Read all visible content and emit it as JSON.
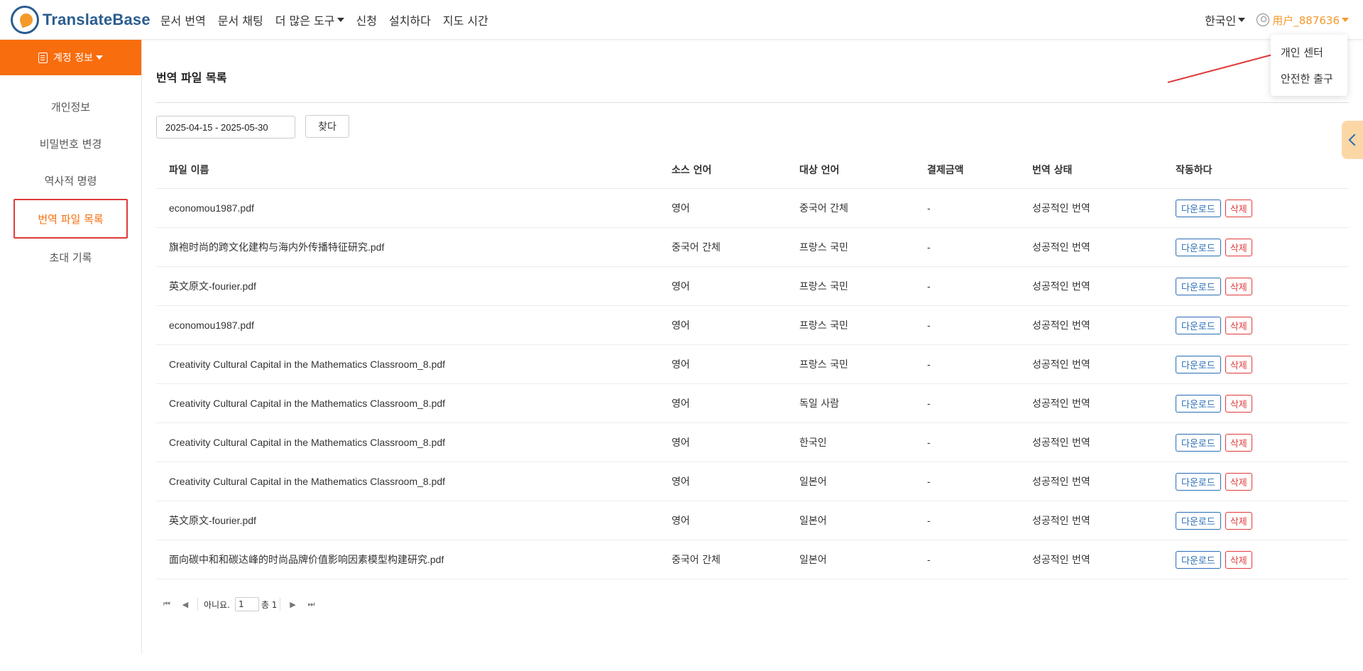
{
  "header": {
    "logo_text": "TranslateBase",
    "nav": [
      {
        "label": "문서 번역",
        "has_caret": false
      },
      {
        "label": "문서 채팅",
        "has_caret": false
      },
      {
        "label": "더 많은 도구",
        "has_caret": true
      },
      {
        "label": "신청",
        "has_caret": false
      },
      {
        "label": "설치하다",
        "has_caret": false
      },
      {
        "label": "지도 시간",
        "has_caret": false
      }
    ],
    "language": "한국인",
    "username": "用户_887636"
  },
  "user_menu": {
    "items": [
      "개인 센터",
      "안전한 출구"
    ]
  },
  "sidebar": {
    "header": "계정 정보",
    "items": [
      {
        "label": "개인정보",
        "active": false
      },
      {
        "label": "비밀번호 변경",
        "active": false
      },
      {
        "label": "역사적 명령",
        "active": false
      },
      {
        "label": "번역 파일 목록",
        "active": true
      },
      {
        "label": "초대 기록",
        "active": false
      }
    ]
  },
  "main": {
    "title": "번역 파일 목록",
    "date_range": "2025-04-15 - 2025-05-30",
    "search_label": "찾다",
    "columns": [
      "파일 이름",
      "소스 언어",
      "대상 언어",
      "결제금액",
      "번역 상태",
      "작동하다"
    ],
    "action_download": "다운로드",
    "action_delete": "삭제",
    "rows": [
      [
        "economou1987.pdf",
        "영어",
        "중국어 간체",
        "-",
        "성공적인 번역"
      ],
      [
        "旗袍时尚的跨文化建构与海内外传播特征研究.pdf",
        "중국어 간체",
        "프랑스 국민",
        "-",
        "성공적인 번역"
      ],
      [
        "英文原文-fourier.pdf",
        "영어",
        "프랑스 국민",
        "-",
        "성공적인 번역"
      ],
      [
        "economou1987.pdf",
        "영어",
        "프랑스 국민",
        "-",
        "성공적인 번역"
      ],
      [
        "Creativity Cultural Capital in the Mathematics Classroom_8.pdf",
        "영어",
        "프랑스 국민",
        "-",
        "성공적인 번역"
      ],
      [
        "Creativity Cultural Capital in the Mathematics Classroom_8.pdf",
        "영어",
        "독일 사람",
        "-",
        "성공적인 번역"
      ],
      [
        "Creativity Cultural Capital in the Mathematics Classroom_8.pdf",
        "영어",
        "한국인",
        "-",
        "성공적인 번역"
      ],
      [
        "Creativity Cultural Capital in the Mathematics Classroom_8.pdf",
        "영어",
        "일본어",
        "-",
        "성공적인 번역"
      ],
      [
        "英文原文-fourier.pdf",
        "영어",
        "일본어",
        "-",
        "성공적인 번역"
      ],
      [
        "面向碳中和和碳达峰的时尚品牌价值影响因素模型构建研究.pdf",
        "중국어 간체",
        "일본어",
        "-",
        "성공적인 번역"
      ]
    ]
  },
  "pager": {
    "prefix": "아니요.",
    "page": "1",
    "total": "총 1"
  },
  "colors": {
    "accent": "#f86d0d",
    "brand": "#2a5d8f",
    "link_blue": "#2a6db5",
    "danger": "#e03a3a",
    "username": "#f39a2b"
  }
}
